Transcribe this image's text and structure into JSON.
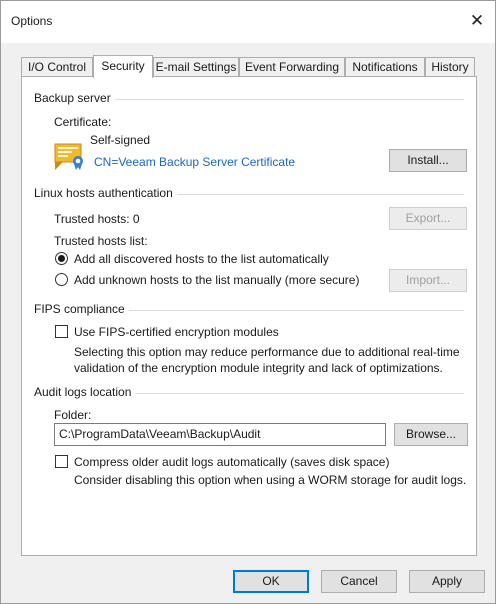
{
  "window": {
    "title": "Options",
    "close_glyph": "✕"
  },
  "tabs": [
    {
      "label": "I/O Control"
    },
    {
      "label": "Security"
    },
    {
      "label": "E-mail Settings"
    },
    {
      "label": "Event Forwarding"
    },
    {
      "label": "Notifications"
    },
    {
      "label": "History"
    }
  ],
  "active_tab": "Security",
  "backup_server": {
    "heading": "Backup server",
    "certificate_label": "Certificate:",
    "certificate_type": "Self-signed",
    "certificate_name": "CN=Veeam Backup Server Certificate",
    "certificate_icon": "certificate-icon",
    "install_button": "Install..."
  },
  "linux_auth": {
    "heading": "Linux hosts authentication",
    "trusted_hosts": "Trusted hosts: 0",
    "export_button": "Export...",
    "trusted_list_label": "Trusted hosts list:",
    "option_auto": "Add all discovered hosts to the list automatically",
    "option_manual": "Add unknown hosts to the list manually (more secure)",
    "import_button": "Import...",
    "selected_option": "auto"
  },
  "fips": {
    "heading": "FIPS compliance",
    "checkbox_label": "Use FIPS-certified encryption modules",
    "checked": false,
    "description_line1": "Selecting this option may reduce performance due to additional real-time",
    "description_line2": "validation of the encryption module integrity and lack of optimizations."
  },
  "audit_logs": {
    "heading": "Audit logs location",
    "folder_label": "Folder:",
    "folder_value": "C:\\ProgramData\\Veeam\\Backup\\Audit",
    "browse_button": "Browse...",
    "compress_label": "Compress older audit logs automatically (saves disk space)",
    "compress_checked": false,
    "worm_note": "Consider disabling this option when using a WORM storage for audit logs."
  },
  "footer": {
    "ok_button": "OK",
    "cancel_button": "Cancel",
    "apply_button": "Apply"
  },
  "colors": {
    "link": "#1a66c8",
    "certificate_yellow": "#f2b830",
    "certificate_blue": "#3a7fd1"
  }
}
